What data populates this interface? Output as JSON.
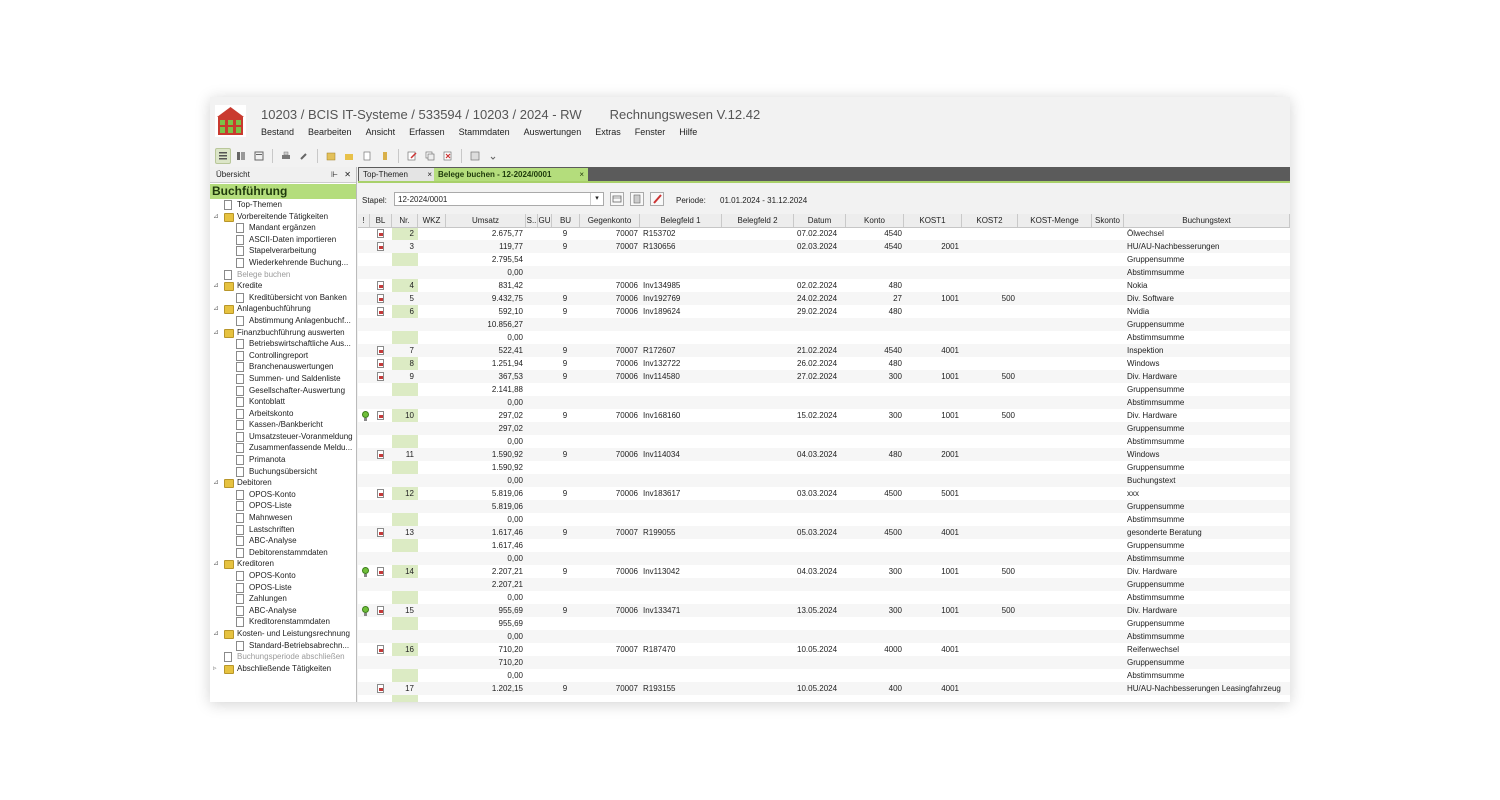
{
  "window": {
    "title": "10203 / BCIS IT-Systeme / 533594 / 10203 / 2024 - RW",
    "version": "Rechnungswesen V.12.42"
  },
  "menu": [
    "Bestand",
    "Bearbeiten",
    "Ansicht",
    "Erfassen",
    "Stammdaten",
    "Auswertungen",
    "Extras",
    "Fenster",
    "Hilfe"
  ],
  "toolbar": [
    "list-view-icon",
    "grid-view-icon",
    "details-view-icon",
    "print-icon",
    "tools-icon",
    "import-icon",
    "folder-icon",
    "export-icon",
    "attach-icon",
    "edit-icon",
    "copy-icon",
    "delete-icon",
    "window-icon",
    "more-icon"
  ],
  "left_panel": {
    "header": "Übersicht",
    "banner": "Buchführung",
    "tree": [
      {
        "label": "Top-Themen",
        "level": 1,
        "type": "page",
        "expand": ""
      },
      {
        "label": "Vorbereitende Tätigkeiten",
        "level": 1,
        "type": "folder",
        "expand": "⊿"
      },
      {
        "label": "Mandant ergänzen",
        "level": 2,
        "type": "page",
        "expand": ""
      },
      {
        "label": "ASCII-Daten importieren",
        "level": 2,
        "type": "page",
        "expand": ""
      },
      {
        "label": "Stapelverarbeitung",
        "level": 2,
        "type": "page",
        "expand": ""
      },
      {
        "label": "Wiederkehrende Buchung...",
        "level": 2,
        "type": "page",
        "expand": ""
      },
      {
        "label": "Belege buchen",
        "level": 1,
        "type": "page",
        "expand": "",
        "disabled": true
      },
      {
        "label": "Kredite",
        "level": 1,
        "type": "folder",
        "expand": "⊿"
      },
      {
        "label": "Kreditübersicht von Banken",
        "level": 2,
        "type": "page",
        "expand": ""
      },
      {
        "label": "Anlagenbuchführung",
        "level": 1,
        "type": "folder",
        "expand": "⊿"
      },
      {
        "label": "Abstimmung Anlagenbuchf...",
        "level": 2,
        "type": "page",
        "expand": ""
      },
      {
        "label": "Finanzbuchführung auswerten",
        "level": 1,
        "type": "folder",
        "expand": "⊿"
      },
      {
        "label": "Betriebswirtschaftliche Aus...",
        "level": 2,
        "type": "page",
        "expand": ""
      },
      {
        "label": "Controllingreport",
        "level": 2,
        "type": "page",
        "expand": ""
      },
      {
        "label": "Branchenauswertungen",
        "level": 2,
        "type": "page",
        "expand": ""
      },
      {
        "label": "Summen- und Saldenliste",
        "level": 2,
        "type": "page",
        "expand": ""
      },
      {
        "label": "Gesellschafter-Auswertung",
        "level": 2,
        "type": "page",
        "expand": ""
      },
      {
        "label": "Kontoblatt",
        "level": 2,
        "type": "page",
        "expand": ""
      },
      {
        "label": "Arbeitskonto",
        "level": 2,
        "type": "page",
        "expand": ""
      },
      {
        "label": "Kassen-/Bankbericht",
        "level": 2,
        "type": "page",
        "expand": ""
      },
      {
        "label": "Umsatzsteuer-Voranmeldung",
        "level": 2,
        "type": "page",
        "expand": ""
      },
      {
        "label": "Zusammenfassende Meldu...",
        "level": 2,
        "type": "page",
        "expand": ""
      },
      {
        "label": "Primanota",
        "level": 2,
        "type": "page",
        "expand": ""
      },
      {
        "label": "Buchungsübersicht",
        "level": 2,
        "type": "page",
        "expand": ""
      },
      {
        "label": "Debitoren",
        "level": 1,
        "type": "folder",
        "expand": "⊿"
      },
      {
        "label": "OPOS-Konto",
        "level": 2,
        "type": "page",
        "expand": ""
      },
      {
        "label": "OPOS-Liste",
        "level": 2,
        "type": "page",
        "expand": ""
      },
      {
        "label": "Mahnwesen",
        "level": 2,
        "type": "page",
        "expand": ""
      },
      {
        "label": "Lastschriften",
        "level": 2,
        "type": "page",
        "expand": ""
      },
      {
        "label": "ABC-Analyse",
        "level": 2,
        "type": "page",
        "expand": ""
      },
      {
        "label": "Debitorenstammdaten",
        "level": 2,
        "type": "page",
        "expand": ""
      },
      {
        "label": "Kreditoren",
        "level": 1,
        "type": "folder",
        "expand": "⊿"
      },
      {
        "label": "OPOS-Konto",
        "level": 2,
        "type": "page",
        "expand": ""
      },
      {
        "label": "OPOS-Liste",
        "level": 2,
        "type": "page",
        "expand": ""
      },
      {
        "label": "Zahlungen",
        "level": 2,
        "type": "page",
        "expand": ""
      },
      {
        "label": "ABC-Analyse",
        "level": 2,
        "type": "page",
        "expand": ""
      },
      {
        "label": "Kreditorenstammdaten",
        "level": 2,
        "type": "page",
        "expand": ""
      },
      {
        "label": "Kosten- und Leistungsrechnung",
        "level": 1,
        "type": "folder",
        "expand": "⊿"
      },
      {
        "label": "Standard-Betriebsabrechn...",
        "level": 2,
        "type": "page",
        "expand": ""
      },
      {
        "label": "Buchungsperiode abschließen",
        "level": 1,
        "type": "page",
        "expand": "",
        "disabled": true
      },
      {
        "label": "Abschließende Tätigkeiten",
        "level": 1,
        "type": "folder",
        "expand": "▹"
      }
    ]
  },
  "tabs": [
    {
      "label": "Top-Themen",
      "close": "×"
    },
    {
      "label": "Belege buchen - 12-2024/0001",
      "close": "×"
    }
  ],
  "stapel": {
    "label": "Stapel:",
    "value": "12-2024/0001",
    "dropdown": "▾",
    "periode_label": "Periode:",
    "periode_value": "01.01.2024 - 31.12.2024"
  },
  "grid": {
    "columns": [
      "!",
      "BL",
      "Nr.",
      "WKZ",
      "Umsatz",
      "S..",
      "GU",
      "BU",
      "Gegenkonto",
      "Belegfeld 1",
      "Belegfeld 2",
      "Datum",
      "Konto",
      "KOST1",
      "KOST2",
      "KOST-Menge",
      "Skonto",
      "Buchungstext"
    ],
    "rows": [
      {
        "bulb": false,
        "bl": true,
        "nr": "2",
        "umsatz": "2.675,77",
        "bu": "9",
        "gk": "70007",
        "bf1": "R153702",
        "datum": "07.02.2024",
        "konto": "4540",
        "kost1": "",
        "kost2": "",
        "text": "Ölwechsel"
      },
      {
        "bulb": false,
        "bl": true,
        "nr": "3",
        "umsatz": "119,77",
        "bu": "9",
        "gk": "70007",
        "bf1": "R130656",
        "datum": "02.03.2024",
        "konto": "4540",
        "kost1": "2001",
        "kost2": "",
        "text": "HU/AU-Nachbesserungen"
      },
      {
        "bulb": false,
        "bl": false,
        "nr": "",
        "umsatz": "2.795,54",
        "bu": "",
        "gk": "",
        "bf1": "",
        "datum": "",
        "konto": "",
        "kost1": "",
        "kost2": "",
        "text": "Gruppensumme"
      },
      {
        "bulb": false,
        "bl": false,
        "nr": "",
        "umsatz": "0,00",
        "bu": "",
        "gk": "",
        "bf1": "",
        "datum": "",
        "konto": "",
        "kost1": "",
        "kost2": "",
        "text": "Abstimmsumme"
      },
      {
        "bulb": false,
        "bl": true,
        "nr": "4",
        "umsatz": "831,42",
        "bu": "",
        "gk": "70006",
        "bf1": "Inv134985",
        "datum": "02.02.2024",
        "konto": "480",
        "kost1": "",
        "kost2": "",
        "text": "Nokia"
      },
      {
        "bulb": false,
        "bl": true,
        "nr": "5",
        "umsatz": "9.432,75",
        "bu": "9",
        "gk": "70006",
        "bf1": "Inv192769",
        "datum": "24.02.2024",
        "konto": "27",
        "kost1": "1001",
        "kost2": "500",
        "text": "Div. Software"
      },
      {
        "bulb": false,
        "bl": true,
        "nr": "6",
        "umsatz": "592,10",
        "bu": "9",
        "gk": "70006",
        "bf1": "Inv189624",
        "datum": "29.02.2024",
        "konto": "480",
        "kost1": "",
        "kost2": "",
        "text": "Nvidia"
      },
      {
        "bulb": false,
        "bl": false,
        "nr": "",
        "umsatz": "10.856,27",
        "bu": "",
        "gk": "",
        "bf1": "",
        "datum": "",
        "konto": "",
        "kost1": "",
        "kost2": "",
        "text": "Gruppensumme"
      },
      {
        "bulb": false,
        "bl": false,
        "nr": "",
        "umsatz": "0,00",
        "bu": "",
        "gk": "",
        "bf1": "",
        "datum": "",
        "konto": "",
        "kost1": "",
        "kost2": "",
        "text": "Abstimmsumme"
      },
      {
        "bulb": false,
        "bl": true,
        "nr": "7",
        "umsatz": "522,41",
        "bu": "9",
        "gk": "70007",
        "bf1": "R172607",
        "datum": "21.02.2024",
        "konto": "4540",
        "kost1": "4001",
        "kost2": "",
        "text": "Inspektion"
      },
      {
        "bulb": false,
        "bl": true,
        "nr": "8",
        "umsatz": "1.251,94",
        "bu": "9",
        "gk": "70006",
        "bf1": "Inv132722",
        "datum": "26.02.2024",
        "konto": "480",
        "kost1": "",
        "kost2": "",
        "text": "Windows"
      },
      {
        "bulb": false,
        "bl": true,
        "nr": "9",
        "umsatz": "367,53",
        "bu": "9",
        "gk": "70006",
        "bf1": "Inv114580",
        "datum": "27.02.2024",
        "konto": "300",
        "kost1": "1001",
        "kost2": "500",
        "text": "Div. Hardware"
      },
      {
        "bulb": false,
        "bl": false,
        "nr": "",
        "umsatz": "2.141,88",
        "bu": "",
        "gk": "",
        "bf1": "",
        "datum": "",
        "konto": "",
        "kost1": "",
        "kost2": "",
        "text": "Gruppensumme"
      },
      {
        "bulb": false,
        "bl": false,
        "nr": "",
        "umsatz": "0,00",
        "bu": "",
        "gk": "",
        "bf1": "",
        "datum": "",
        "konto": "",
        "kost1": "",
        "kost2": "",
        "text": "Abstimmsumme"
      },
      {
        "bulb": true,
        "bl": true,
        "nr": "10",
        "umsatz": "297,02",
        "bu": "9",
        "gk": "70006",
        "bf1": "Inv168160",
        "datum": "15.02.2024",
        "konto": "300",
        "kost1": "1001",
        "kost2": "500",
        "text": "Div. Hardware"
      },
      {
        "bulb": false,
        "bl": false,
        "nr": "",
        "umsatz": "297,02",
        "bu": "",
        "gk": "",
        "bf1": "",
        "datum": "",
        "konto": "",
        "kost1": "",
        "kost2": "",
        "text": "Gruppensumme"
      },
      {
        "bulb": false,
        "bl": false,
        "nr": "",
        "umsatz": "0,00",
        "bu": "",
        "gk": "",
        "bf1": "",
        "datum": "",
        "konto": "",
        "kost1": "",
        "kost2": "",
        "text": "Abstimmsumme"
      },
      {
        "bulb": false,
        "bl": true,
        "nr": "11",
        "umsatz": "1.590,92",
        "bu": "9",
        "gk": "70006",
        "bf1": "Inv114034",
        "datum": "04.03.2024",
        "konto": "480",
        "kost1": "2001",
        "kost2": "",
        "text": "Windows"
      },
      {
        "bulb": false,
        "bl": false,
        "nr": "",
        "umsatz": "1.590,92",
        "bu": "",
        "gk": "",
        "bf1": "",
        "datum": "",
        "konto": "",
        "kost1": "",
        "kost2": "",
        "text": "Gruppensumme"
      },
      {
        "bulb": false,
        "bl": false,
        "nr": "",
        "umsatz": "0,00",
        "bu": "",
        "gk": "",
        "bf1": "",
        "datum": "",
        "konto": "",
        "kost1": "",
        "kost2": "",
        "text": "Buchungstext"
      },
      {
        "bulb": false,
        "bl": true,
        "nr": "12",
        "umsatz": "5.819,06",
        "bu": "9",
        "gk": "70006",
        "bf1": "Inv183617",
        "datum": "03.03.2024",
        "konto": "4500",
        "kost1": "5001",
        "kost2": "",
        "text": "xxx"
      },
      {
        "bulb": false,
        "bl": false,
        "nr": "",
        "umsatz": "5.819,06",
        "bu": "",
        "gk": "",
        "bf1": "",
        "datum": "",
        "konto": "",
        "kost1": "",
        "kost2": "",
        "text": "Gruppensumme"
      },
      {
        "bulb": false,
        "bl": false,
        "nr": "",
        "umsatz": "0,00",
        "bu": "",
        "gk": "",
        "bf1": "",
        "datum": "",
        "konto": "",
        "kost1": "",
        "kost2": "",
        "text": "Abstimmsumme"
      },
      {
        "bulb": false,
        "bl": true,
        "nr": "13",
        "umsatz": "1.617,46",
        "bu": "9",
        "gk": "70007",
        "bf1": "R199055",
        "datum": "05.03.2024",
        "konto": "4500",
        "kost1": "4001",
        "kost2": "",
        "text": "gesonderte Beratung"
      },
      {
        "bulb": false,
        "bl": false,
        "nr": "",
        "umsatz": "1.617,46",
        "bu": "",
        "gk": "",
        "bf1": "",
        "datum": "",
        "konto": "",
        "kost1": "",
        "kost2": "",
        "text": "Gruppensumme"
      },
      {
        "bulb": false,
        "bl": false,
        "nr": "",
        "umsatz": "0,00",
        "bu": "",
        "gk": "",
        "bf1": "",
        "datum": "",
        "konto": "",
        "kost1": "",
        "kost2": "",
        "text": "Abstimmsumme"
      },
      {
        "bulb": true,
        "bl": true,
        "nr": "14",
        "umsatz": "2.207,21",
        "bu": "9",
        "gk": "70006",
        "bf1": "Inv113042",
        "datum": "04.03.2024",
        "konto": "300",
        "kost1": "1001",
        "kost2": "500",
        "text": "Div. Hardware"
      },
      {
        "bulb": false,
        "bl": false,
        "nr": "",
        "umsatz": "2.207,21",
        "bu": "",
        "gk": "",
        "bf1": "",
        "datum": "",
        "konto": "",
        "kost1": "",
        "kost2": "",
        "text": "Gruppensumme"
      },
      {
        "bulb": false,
        "bl": false,
        "nr": "",
        "umsatz": "0,00",
        "bu": "",
        "gk": "",
        "bf1": "",
        "datum": "",
        "konto": "",
        "kost1": "",
        "kost2": "",
        "text": "Abstimmsumme"
      },
      {
        "bulb": true,
        "bl": true,
        "nr": "15",
        "umsatz": "955,69",
        "bu": "9",
        "gk": "70006",
        "bf1": "Inv133471",
        "datum": "13.05.2024",
        "konto": "300",
        "kost1": "1001",
        "kost2": "500",
        "text": "Div. Hardware"
      },
      {
        "bulb": false,
        "bl": false,
        "nr": "",
        "umsatz": "955,69",
        "bu": "",
        "gk": "",
        "bf1": "",
        "datum": "",
        "konto": "",
        "kost1": "",
        "kost2": "",
        "text": "Gruppensumme"
      },
      {
        "bulb": false,
        "bl": false,
        "nr": "",
        "umsatz": "0,00",
        "bu": "",
        "gk": "",
        "bf1": "",
        "datum": "",
        "konto": "",
        "kost1": "",
        "kost2": "",
        "text": "Abstimmsumme"
      },
      {
        "bulb": false,
        "bl": true,
        "nr": "16",
        "umsatz": "710,20",
        "bu": "",
        "gk": "70007",
        "bf1": "R187470",
        "datum": "10.05.2024",
        "konto": "4000",
        "kost1": "4001",
        "kost2": "",
        "text": "Reifenwechsel"
      },
      {
        "bulb": false,
        "bl": false,
        "nr": "",
        "umsatz": "710,20",
        "bu": "",
        "gk": "",
        "bf1": "",
        "datum": "",
        "konto": "",
        "kost1": "",
        "kost2": "",
        "text": "Gruppensumme"
      },
      {
        "bulb": false,
        "bl": false,
        "nr": "",
        "umsatz": "0,00",
        "bu": "",
        "gk": "",
        "bf1": "",
        "datum": "",
        "konto": "",
        "kost1": "",
        "kost2": "",
        "text": "Abstimmsumme"
      },
      {
        "bulb": false,
        "bl": true,
        "nr": "17",
        "umsatz": "1.202,15",
        "bu": "9",
        "gk": "70007",
        "bf1": "R193155",
        "datum": "10.05.2024",
        "konto": "400",
        "kost1": "4001",
        "kost2": "",
        "text": "HU/AU-Nachbesserungen Leasingfahrzeug"
      }
    ]
  }
}
